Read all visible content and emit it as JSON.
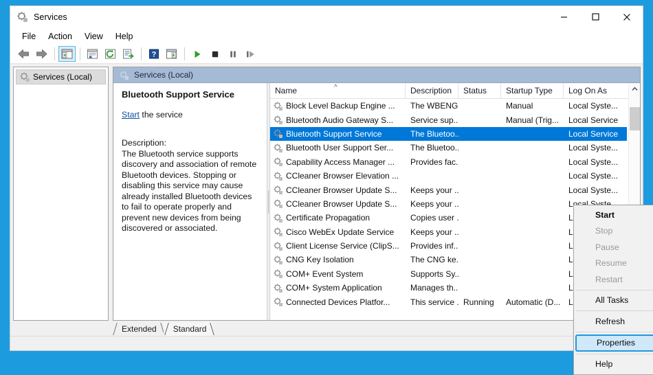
{
  "window": {
    "title": "Services",
    "icon": "gear-icon",
    "caption": {
      "minimize": "minimize-icon",
      "maximize": "maximize-icon",
      "close": "close-icon"
    }
  },
  "menubar": {
    "items": [
      "File",
      "Action",
      "View",
      "Help"
    ]
  },
  "toolbar": {
    "buttons": [
      {
        "name": "back-button",
        "icon": "left-arrow-icon"
      },
      {
        "name": "forward-button",
        "icon": "right-arrow-icon"
      },
      {
        "name": "show-hide-console-tree-button",
        "icon": "console-tree-icon",
        "pressed": true
      },
      {
        "name": "properties-button",
        "icon": "properties-window-icon"
      },
      {
        "name": "refresh-button",
        "icon": "refresh-icon"
      },
      {
        "name": "export-list-button",
        "icon": "export-list-icon"
      },
      {
        "name": "help-button",
        "icon": "help-question-icon"
      },
      {
        "name": "show-action-pane-button",
        "icon": "action-pane-icon"
      },
      {
        "name": "start-service-button",
        "icon": "play-icon"
      },
      {
        "name": "stop-service-button",
        "icon": "stop-icon"
      },
      {
        "name": "pause-service-button",
        "icon": "pause-icon"
      },
      {
        "name": "restart-service-button",
        "icon": "restart-icon"
      }
    ]
  },
  "tree": {
    "root_label": "Services (Local)",
    "icon": "gear-icon"
  },
  "pane": {
    "banner_label": "Services (Local)",
    "banner_icon": "gear-icon"
  },
  "details": {
    "service_name": "Bluetooth Support Service",
    "start_link": "Start",
    "start_suffix": " the service",
    "description_label": "Description:",
    "description": "The Bluetooth service supports discovery and association of remote Bluetooth devices.  Stopping or disabling this service may cause already installed Bluetooth devices to fail to operate properly and prevent new devices from being discovered or associated."
  },
  "list": {
    "columns": [
      "Name",
      "Description",
      "Status",
      "Startup Type",
      "Log On As"
    ],
    "sort_indicator": "^",
    "rows": [
      {
        "name": "Block Level Backup Engine ...",
        "description": "The WBENG...",
        "status": "",
        "startup": "Manual",
        "logon": "Local Syste...",
        "selected": false
      },
      {
        "name": "Bluetooth Audio Gateway S...",
        "description": "Service sup...",
        "status": "",
        "startup": "Manual (Trig...",
        "logon": "Local Service",
        "selected": false
      },
      {
        "name": "Bluetooth Support Service",
        "description": "The Bluetoo...",
        "status": "",
        "startup": "",
        "logon": "Local Service",
        "selected": true
      },
      {
        "name": "Bluetooth User Support Ser...",
        "description": "The Bluetoo...",
        "status": "",
        "startup": "",
        "logon": "Local Syste...",
        "selected": false
      },
      {
        "name": "Capability Access Manager ...",
        "description": "Provides fac...",
        "status": "",
        "startup": "",
        "logon": "Local Syste...",
        "selected": false
      },
      {
        "name": "CCleaner Browser Elevation ...",
        "description": "",
        "status": "",
        "startup": "",
        "logon": "Local Syste...",
        "selected": false
      },
      {
        "name": "CCleaner Browser Update S...",
        "description": "Keeps your ...",
        "status": "",
        "startup": "",
        "logon": "Local Syste...",
        "selected": false
      },
      {
        "name": "CCleaner Browser Update S...",
        "description": "Keeps your ...",
        "status": "",
        "startup": "",
        "logon": "Local Syste...",
        "selected": false
      },
      {
        "name": "Certificate Propagation",
        "description": "Copies user ...",
        "status": "",
        "startup": "",
        "logon": "Local Syste...",
        "selected": false
      },
      {
        "name": "Cisco WebEx Update Service",
        "description": "Keeps your ...",
        "status": "",
        "startup": "",
        "logon": "Local Syste...",
        "selected": false
      },
      {
        "name": "Client License Service (ClipS...",
        "description": "Provides inf...",
        "status": "",
        "startup": "",
        "logon": "Local Syste...",
        "selected": false
      },
      {
        "name": "CNG Key Isolation",
        "description": "The CNG ke...",
        "status": "",
        "startup": "",
        "logon": "Local Syste...",
        "selected": false
      },
      {
        "name": "COM+ Event System",
        "description": "Supports Sy...",
        "status": "",
        "startup": "",
        "logon": "Local Service",
        "selected": false
      },
      {
        "name": "COM+ System Application",
        "description": "Manages th...",
        "status": "",
        "startup": "",
        "logon": "Local Syste...",
        "selected": false
      },
      {
        "name": "Connected Devices Platfor...",
        "description": "This service ...",
        "status": "Running",
        "startup": "Automatic (D...",
        "logon": "Local Service",
        "selected": false
      }
    ]
  },
  "context_menu": {
    "items": [
      {
        "label": "Start",
        "state": "default",
        "type": "item"
      },
      {
        "label": "Stop",
        "state": "disabled",
        "type": "item"
      },
      {
        "label": "Pause",
        "state": "disabled",
        "type": "item"
      },
      {
        "label": "Resume",
        "state": "disabled",
        "type": "item"
      },
      {
        "label": "Restart",
        "state": "disabled",
        "type": "item"
      },
      {
        "type": "separator"
      },
      {
        "label": "All Tasks",
        "state": "normal",
        "type": "submenu",
        "submark": "›"
      },
      {
        "type": "separator"
      },
      {
        "label": "Refresh",
        "state": "normal",
        "type": "item"
      },
      {
        "type": "separator"
      },
      {
        "label": "Properties",
        "state": "highlighted",
        "type": "item"
      },
      {
        "type": "separator"
      },
      {
        "label": "Help",
        "state": "normal",
        "type": "item"
      }
    ]
  },
  "tabs": [
    {
      "label": "Extended",
      "active": false
    },
    {
      "label": "Standard",
      "active": true
    }
  ],
  "scrollbar": {
    "up": "chevron-up-icon",
    "down": "chevron-down-icon"
  },
  "colors": {
    "desktop": "#1d9bdf",
    "selection": "#0078d7",
    "banner": "#a5bad4",
    "highlight_border": "#2196dd",
    "link": "#0b4f9e"
  }
}
